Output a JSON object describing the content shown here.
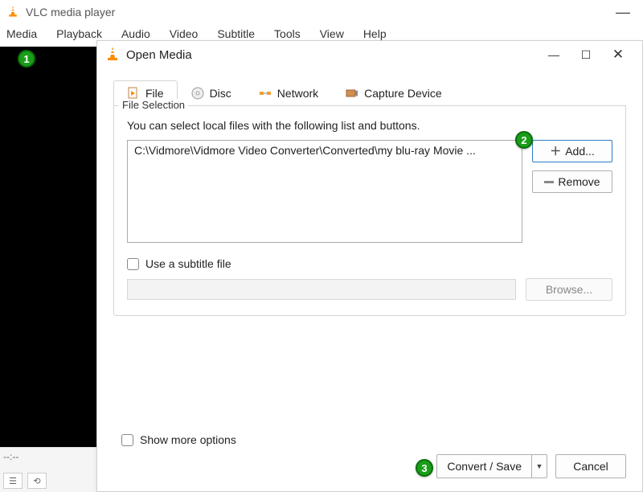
{
  "main": {
    "title": "VLC media player",
    "menu": [
      "Media",
      "Playback",
      "Audio",
      "Video",
      "Subtitle",
      "Tools",
      "View",
      "Help"
    ],
    "time": "--:--"
  },
  "dialog": {
    "title": "Open Media",
    "tabs": {
      "file": "File",
      "disc": "Disc",
      "network": "Network",
      "capture": "Capture Device"
    },
    "file_selection": {
      "group_label": "File Selection",
      "hint": "You can select local files with the following list and buttons.",
      "selected_file": "C:\\Vidmore\\Vidmore Video Converter\\Converted\\my blu-ray Movie ...",
      "add_label": "Add...",
      "remove_label": "Remove",
      "subtitle_label": "Use a subtitle file",
      "browse_label": "Browse..."
    },
    "show_more": "Show more options",
    "convert_label": "Convert / Save",
    "cancel_label": "Cancel"
  },
  "badges": {
    "one": "1",
    "two": "2",
    "three": "3"
  }
}
